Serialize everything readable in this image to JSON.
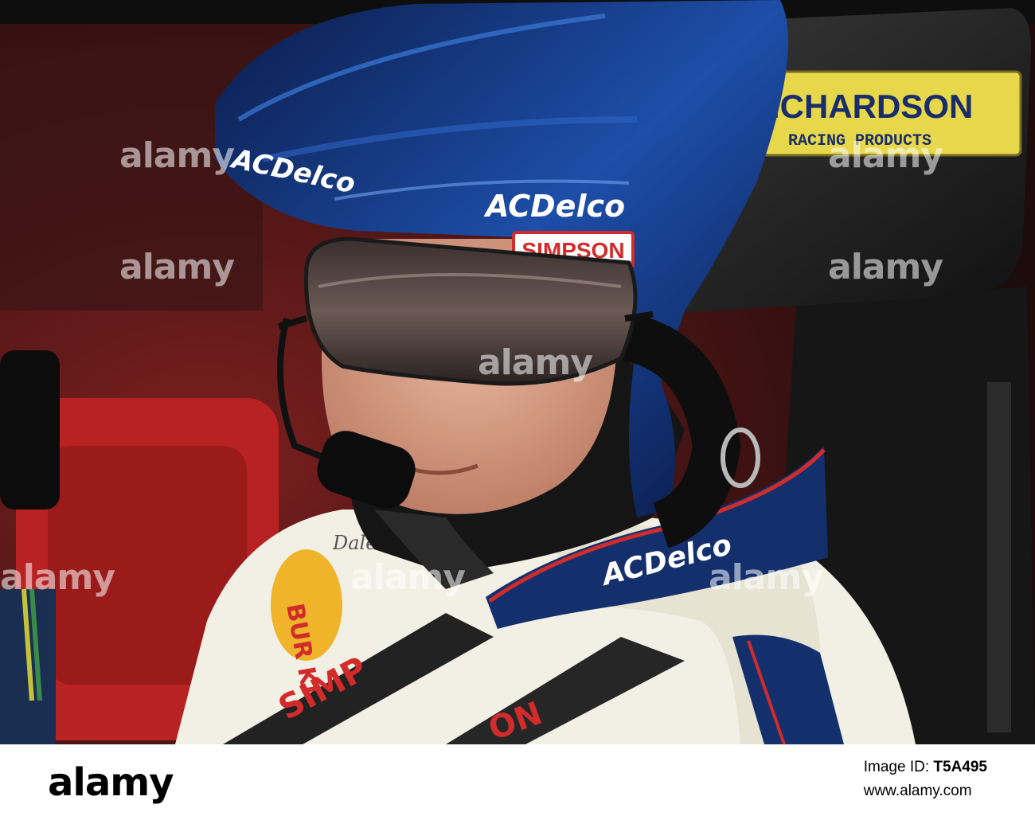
{
  "photo": {
    "helmet_text": [
      "ACDelco",
      "ACDelco"
    ],
    "goggle_brand": "SIMPSON",
    "headrest_title": "RICHARDSON",
    "headrest_subtitle": "RACING PRODUCTS",
    "collar_text": "ACDelco",
    "suit_text": [
      "BUR KI",
      "SIMP",
      "ON",
      "Dale"
    ],
    "watermark": "alamy"
  },
  "footer": {
    "logo": "alamy",
    "image_id_label": "Image ID: ",
    "image_id": "T5A495",
    "site": "www.alamy.com"
  },
  "colors": {
    "helmet_blue": "#0f2a6e",
    "badge_yellow": "#e6d84a",
    "simpson_red": "#d22b2b",
    "suit_white": "#f2f0e4"
  }
}
